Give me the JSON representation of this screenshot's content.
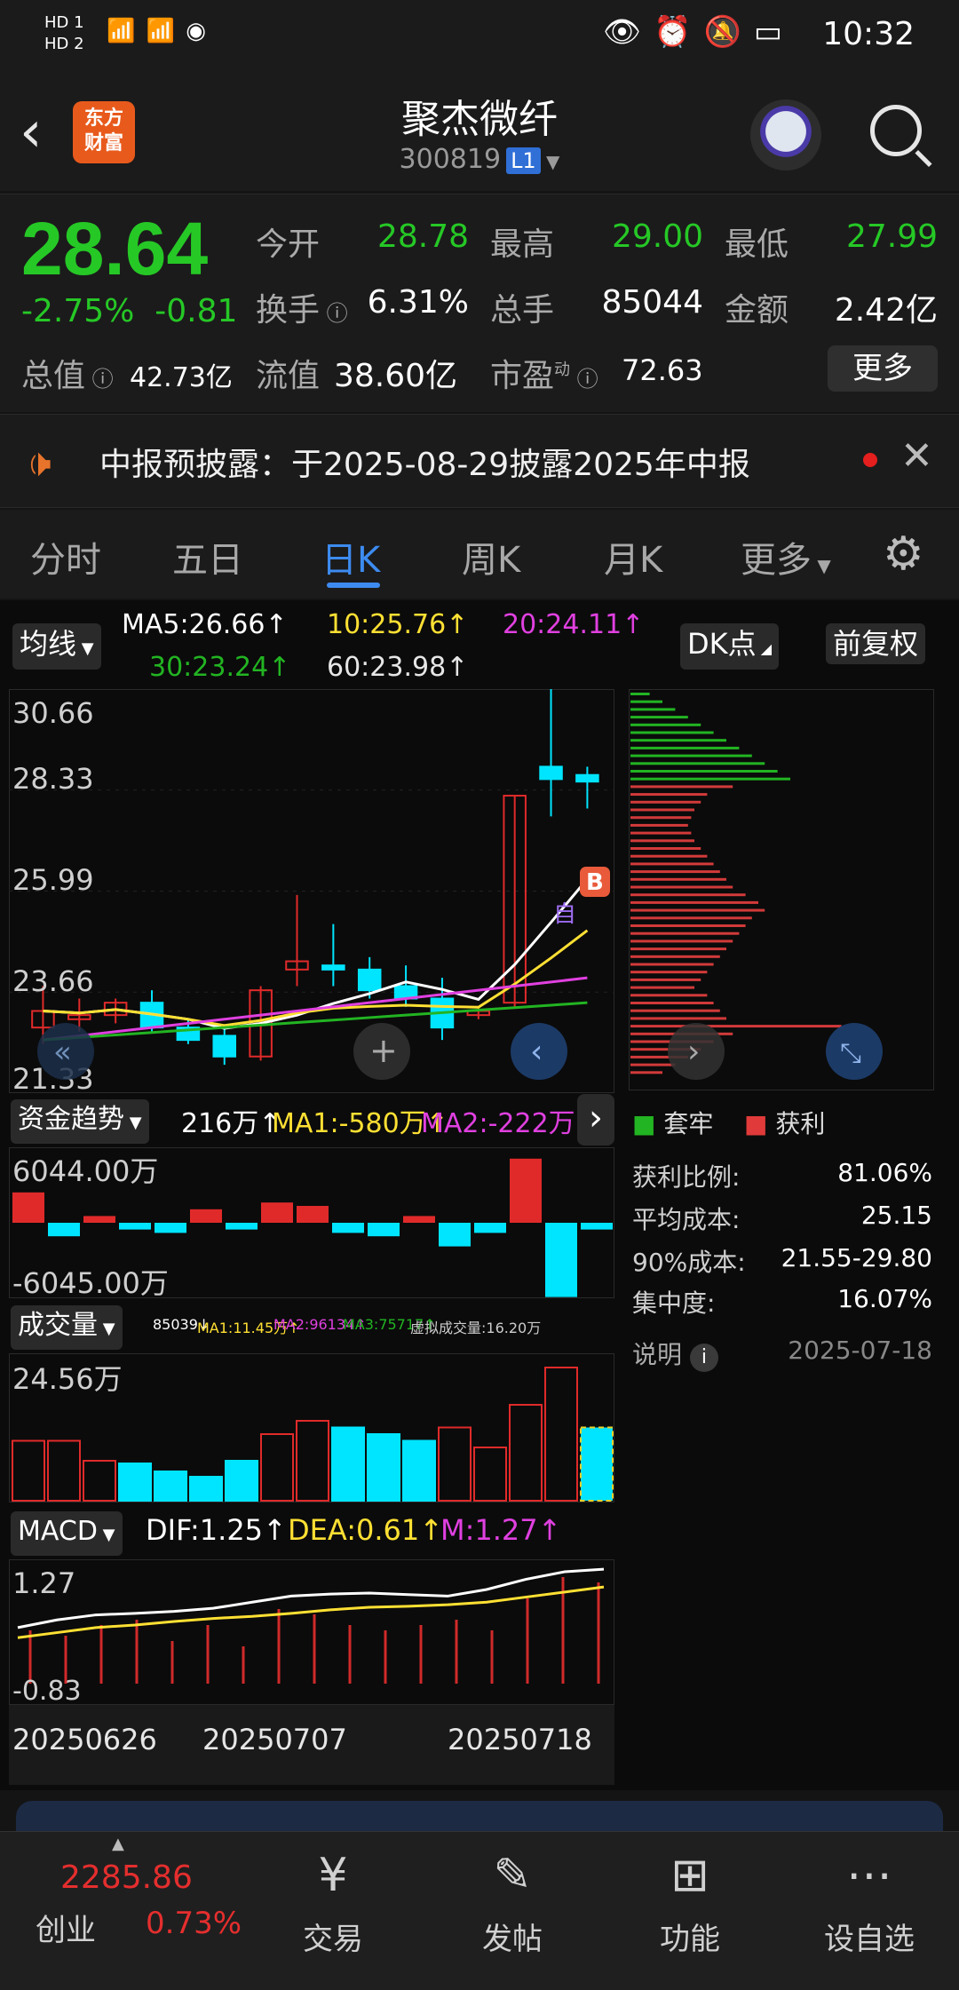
{
  "status_bar": {
    "time": "10:32",
    "left_labels": [
      "HD 1",
      "HD 2"
    ],
    "signal_text": "4G 4G",
    "wifi_count": "1"
  },
  "header": {
    "title": "聚杰微纤",
    "code": "300819",
    "level_badge": "L1",
    "logo_text": "东方财富"
  },
  "quote": {
    "price": "28.64",
    "change_pct": "-2.75%",
    "change_abs": "-0.81",
    "fields": [
      {
        "label": "今开",
        "value": "28.78"
      },
      {
        "label": "最高",
        "value": "29.00"
      },
      {
        "label": "最低",
        "value": "27.99"
      },
      {
        "label": "换手",
        "value": "6.31%"
      },
      {
        "label": "总手",
        "value": "85044"
      },
      {
        "label": "金额",
        "value": "2.42亿"
      },
      {
        "label": "总值",
        "value": "42.73亿"
      },
      {
        "label": "流值",
        "value": "38.60亿"
      },
      {
        "label": "市盈",
        "value": "72.63",
        "superscript": "动"
      }
    ],
    "more_label": "更多"
  },
  "notice": {
    "text": "中报预披露：于2025-08-29披露2025年中报"
  },
  "tabs": [
    "分时",
    "五日",
    "日K",
    "周K",
    "月K",
    "更多"
  ],
  "active_tab": "日K",
  "ma_bar": {
    "dropdown": "均线",
    "ma5": "MA5:26.66↑",
    "ma10": "10:25.76↑",
    "ma20": "20:24.11↑",
    "ma30": "30:23.24↑",
    "ma60": "60:23.98↑",
    "dk_button": "DK点",
    "fq_button": "前复权"
  },
  "kline": {
    "y_labels": [
      "30.66",
      "28.33",
      "25.99",
      "23.66",
      "21.33"
    ],
    "marker_b": "B",
    "marker_self": "自"
  },
  "fund_flow": {
    "dropdown": "资金趋势",
    "value": "216万↑",
    "ma1": "MA1:-580万↑",
    "ma2": "MA2:-222万↑",
    "top": "6044.00万",
    "bottom": "-6045.00万"
  },
  "volume": {
    "dropdown": "成交量",
    "value": "85039↓",
    "ma1": "MA1:11.45万↑",
    "ma2": "MA2:96134↑",
    "ma3": "MA3:75717↑",
    "virtual": "虚拟成交量:16.20万",
    "top": "24.56万"
  },
  "macd": {
    "dropdown": "MACD",
    "dif": "DIF:1.25↑",
    "dea": "DEA:0.61↑",
    "m": "M:1.27↑",
    "top": "1.27",
    "bottom": "-0.83"
  },
  "dates": [
    "20250626",
    "20250707",
    "20250718"
  ],
  "chips": {
    "legend_trap": "套牢",
    "legend_profit": "获利",
    "stats": [
      {
        "label": "获利比例:",
        "value": "81.06%"
      },
      {
        "label": "平均成本:",
        "value": "25.15"
      },
      {
        "label": "90%成本:",
        "value": "21.55-29.80"
      },
      {
        "label": "集中度:",
        "value": "16.07%"
      }
    ],
    "note_label": "说明",
    "note_date": "2025-07-18"
  },
  "bottom_nav": {
    "index_value": "2285.86",
    "index_name": "创业",
    "index_pct": "0.73%",
    "items": [
      "交易",
      "发帖",
      "功能",
      "设自选"
    ]
  },
  "chart_data": {
    "type": "candlestick",
    "dates_shown": [
      "20250626",
      "20250707",
      "20250718"
    ],
    "ohlc": [
      [
        22.7,
        23.7,
        22.3,
        23.1
      ],
      [
        22.9,
        23.4,
        22.6,
        23.0
      ],
      [
        23.0,
        23.4,
        22.8,
        23.3
      ],
      [
        23.3,
        23.6,
        22.6,
        22.7
      ],
      [
        22.7,
        22.9,
        22.3,
        22.4
      ],
      [
        22.5,
        22.7,
        21.8,
        22.0
      ],
      [
        22.0,
        23.7,
        21.9,
        23.6
      ],
      [
        24.1,
        25.9,
        23.7,
        24.3
      ],
      [
        24.2,
        25.2,
        23.7,
        24.1
      ],
      [
        24.1,
        24.4,
        23.4,
        23.6
      ],
      [
        23.7,
        24.2,
        23.2,
        23.4
      ],
      [
        23.4,
        23.9,
        22.4,
        22.7
      ],
      [
        23.0,
        23.2,
        22.9,
        23.1
      ],
      [
        23.3,
        28.3,
        23.2,
        28.3
      ],
      [
        29.0,
        31.0,
        27.8,
        28.7
      ],
      [
        28.8,
        29.0,
        27.99,
        28.64
      ]
    ],
    "ylim": [
      21.33,
      30.66
    ],
    "ma": {
      "MA5": 26.66,
      "MA10": 25.76,
      "MA20": 24.11,
      "MA30": 23.24,
      "MA60": 23.98
    },
    "colors": {
      "up": "#e02a2a",
      "down": "#00e5ff",
      "ma5": "#ffffff",
      "ma10": "#ffe033",
      "ma20": "#e040e0",
      "ma30": "#22b422"
    }
  }
}
